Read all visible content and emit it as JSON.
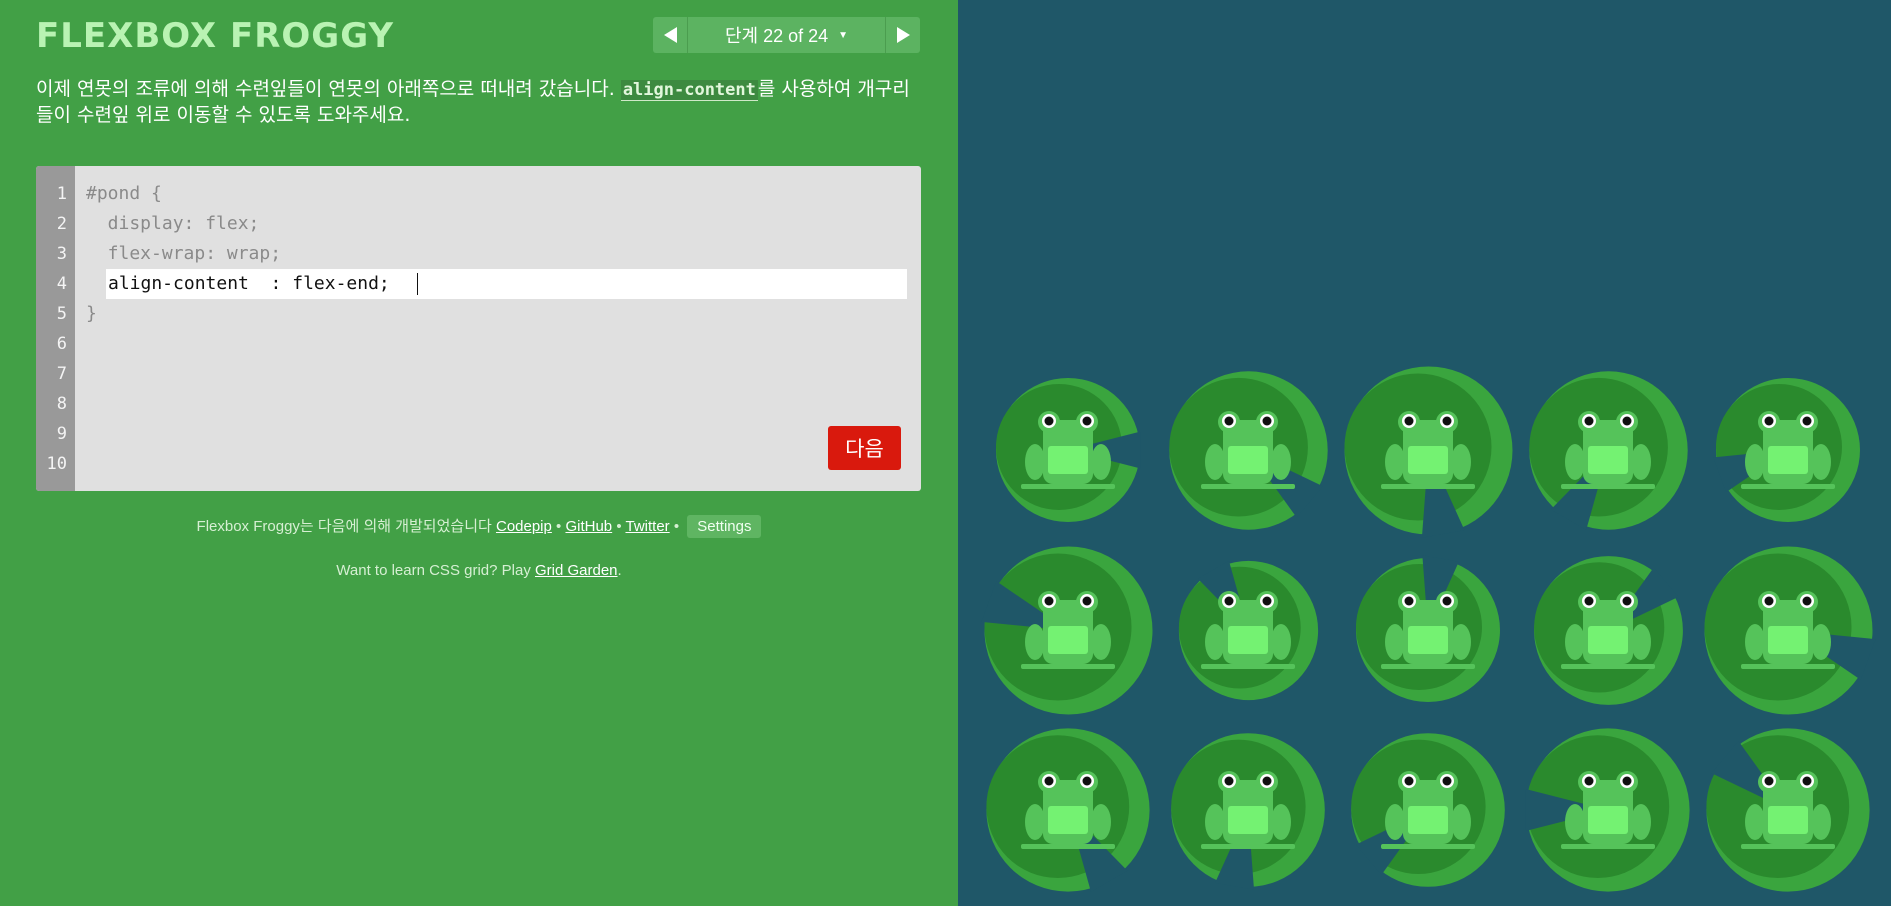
{
  "app": {
    "title": "FLEXBOX FROGGY"
  },
  "level_nav": {
    "label": "단계 22 of 24",
    "caret": "▼",
    "current": 22,
    "total": 24
  },
  "instructions": {
    "before": "이제 연못의 조류에 의해 수련잎들이 연못의 아래쪽으로 떠내려 갔습니다. ",
    "keyword": "align-content",
    "after": "를 사용하여 개구리들이 수련잎 위로 이동할 수 있도록 도와주세요."
  },
  "editor": {
    "line_numbers": [
      "1",
      "2",
      "3",
      "4",
      "5",
      "6",
      "7",
      "8",
      "9",
      "10"
    ],
    "lines": [
      "#pond {",
      "  display: flex;",
      "  flex-wrap: wrap;",
      "",
      "}"
    ],
    "input_value": "align-content  : flex-end;",
    "next_label": "다음"
  },
  "credits": {
    "text": "Flexbox Froggy는 다음에 의해 개발되었습니다",
    "link1": "Codepip",
    "sep": " • ",
    "link2": "GitHub",
    "link3": "Twitter",
    "settings": "Settings"
  },
  "promo": {
    "text": "Want to learn CSS grid? Play ",
    "link": "Grid Garden",
    "end": "."
  },
  "colors": {
    "sidebar_bg": "#42a046",
    "pond_bg": "#1f5768",
    "lilypad_light": "#3aa53e",
    "lilypad_dark": "#2a8a2d",
    "frog_body": "#55c35a",
    "frog_belly": "#74f272",
    "next_button": "#d9190d"
  },
  "pond": {
    "rows": 3,
    "cols": 5,
    "frog_color": "green",
    "frog_count": 15,
    "lilypad_count": 15
  }
}
